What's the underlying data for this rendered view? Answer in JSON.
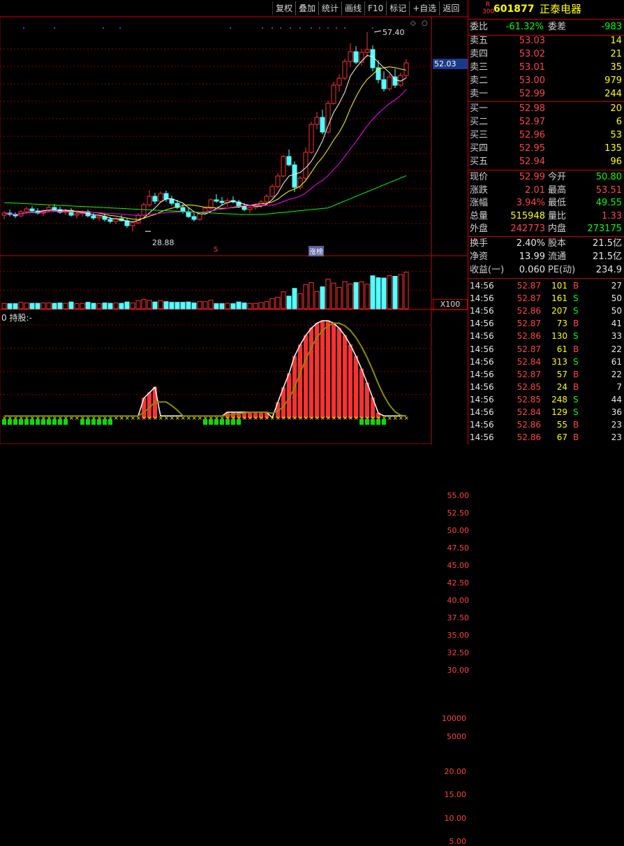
{
  "toolbar": [
    "复权",
    "叠加",
    "统计",
    "画线",
    "F10",
    "标记",
    "+自选",
    "返回"
  ],
  "stock": {
    "badge_top": "R",
    "badge_bottom": "300",
    "code": "601877",
    "name": "正泰电器"
  },
  "price_axis": [
    "55.00",
    "52.50",
    "50.00",
    "47.50",
    "45.00",
    "42.50",
    "40.00",
    "37.50",
    "35.00",
    "32.50",
    "30.00"
  ],
  "current_price_tag": "52.03",
  "high_marker": "57.40",
  "low_marker": "28.88",
  "event_marks": [
    "S",
    "涨榜"
  ],
  "volume_axis": [
    "10000",
    "5000"
  ],
  "volume_unit": "X100",
  "indicator_title": "0 持股:-",
  "indicator_axis": [
    "20.00",
    "15.00",
    "10.00",
    "5.00"
  ],
  "weibi": {
    "label": "委比",
    "value": "-61.32%",
    "diff_label": "委差",
    "diff": "-983"
  },
  "asks": [
    {
      "label": "卖五",
      "price": "53.03",
      "vol": "14"
    },
    {
      "label": "卖四",
      "price": "53.02",
      "vol": "21"
    },
    {
      "label": "卖三",
      "price": "53.01",
      "vol": "35"
    },
    {
      "label": "卖二",
      "price": "53.00",
      "vol": "979"
    },
    {
      "label": "卖一",
      "price": "52.99",
      "vol": "244"
    }
  ],
  "bids": [
    {
      "label": "买一",
      "price": "52.98",
      "vol": "20"
    },
    {
      "label": "买二",
      "price": "52.97",
      "vol": "6"
    },
    {
      "label": "买三",
      "price": "52.96",
      "vol": "53"
    },
    {
      "label": "买四",
      "price": "52.95",
      "vol": "135"
    },
    {
      "label": "买五",
      "price": "52.94",
      "vol": "96"
    }
  ],
  "stats": [
    {
      "l1": "现价",
      "v1": "52.99",
      "l2": "今开",
      "v2": "50.80",
      "c1": "red",
      "c2": "green"
    },
    {
      "l1": "涨跌",
      "v1": "2.01",
      "l2": "最高",
      "v2": "53.51",
      "c1": "red",
      "c2": "red"
    },
    {
      "l1": "涨幅",
      "v1": "3.94%",
      "l2": "最低",
      "v2": "49.55",
      "c1": "red",
      "c2": "green"
    },
    {
      "l1": "总量",
      "v1": "515948",
      "l2": "量比",
      "v2": "1.33",
      "c1": "yel",
      "c2": "red"
    },
    {
      "l1": "外盘",
      "v1": "242773",
      "l2": "内盘",
      "v2": "273175",
      "c1": "red",
      "c2": "green"
    }
  ],
  "fundamentals": [
    {
      "l1": "换手",
      "v1": "2.40%",
      "l2": "股本",
      "v2": "21.5亿"
    },
    {
      "l1": "净资",
      "v1": "13.99",
      "l2": "流通",
      "v2": "21.5亿"
    },
    {
      "l1": "收益(一)",
      "v1": "0.060",
      "l2": "PE(动)",
      "v2": "234.9"
    }
  ],
  "ticks": [
    {
      "t": "14:56",
      "p": "52.87",
      "v": "101",
      "s": "B",
      "n": "27"
    },
    {
      "t": "14:56",
      "p": "52.87",
      "v": "161",
      "s": "S",
      "n": "50"
    },
    {
      "t": "14:56",
      "p": "52.86",
      "v": "207",
      "s": "S",
      "n": "50"
    },
    {
      "t": "14:56",
      "p": "52.87",
      "v": "73",
      "s": "B",
      "n": "41"
    },
    {
      "t": "14:56",
      "p": "52.86",
      "v": "130",
      "s": "S",
      "n": "33"
    },
    {
      "t": "14:56",
      "p": "52.87",
      "v": "61",
      "s": "B",
      "n": "22"
    },
    {
      "t": "14:56",
      "p": "52.84",
      "v": "313",
      "s": "S",
      "n": "61"
    },
    {
      "t": "14:56",
      "p": "52.87",
      "v": "57",
      "s": "B",
      "n": "22"
    },
    {
      "t": "14:56",
      "p": "52.85",
      "v": "24",
      "s": "B",
      "n": "7"
    },
    {
      "t": "14:56",
      "p": "52.85",
      "v": "248",
      "s": "S",
      "n": "44"
    },
    {
      "t": "14:56",
      "p": "52.84",
      "v": "129",
      "s": "S",
      "n": "36"
    },
    {
      "t": "14:56",
      "p": "52.86",
      "v": "55",
      "s": "B",
      "n": "23"
    },
    {
      "t": "14:56",
      "p": "52.86",
      "v": "67",
      "s": "B",
      "n": "23"
    }
  ],
  "colors": {
    "up": "#ff3030",
    "down": "#54ffff",
    "ma5": "#ffffff",
    "ma10": "#ffff00",
    "ma20": "#ff00ff",
    "ma60": "#00ff00",
    "ma120": "#00c000",
    "grid": "#8b0000",
    "indicator_line": "#8b8b00"
  },
  "chart_data": {
    "type": "candlestick",
    "ylim": [
      28,
      58
    ],
    "candles": [
      [
        31.2,
        31.8,
        30.6,
        31.5
      ],
      [
        31.5,
        32.0,
        31.0,
        31.3
      ],
      [
        31.3,
        31.6,
        30.8,
        31.1
      ],
      [
        31.1,
        31.9,
        30.9,
        31.7
      ],
      [
        31.7,
        32.4,
        31.5,
        32.1
      ],
      [
        32.1,
        32.5,
        31.6,
        31.8
      ],
      [
        31.8,
        32.2,
        31.3,
        31.5
      ],
      [
        31.5,
        32.0,
        31.1,
        31.9
      ],
      [
        31.9,
        32.6,
        31.7,
        32.3
      ],
      [
        32.3,
        32.8,
        31.9,
        32.0
      ],
      [
        32.0,
        32.4,
        31.4,
        31.6
      ],
      [
        31.6,
        32.1,
        31.2,
        31.9
      ],
      [
        31.9,
        32.2,
        31.0,
        31.2
      ],
      [
        31.2,
        31.6,
        30.7,
        31.4
      ],
      [
        31.4,
        31.9,
        31.0,
        31.7
      ],
      [
        31.7,
        32.0,
        30.9,
        31.1
      ],
      [
        31.1,
        31.5,
        30.5,
        30.8
      ],
      [
        30.8,
        31.3,
        30.4,
        31.0
      ],
      [
        31.0,
        31.4,
        30.3,
        30.6
      ],
      [
        30.6,
        31.0,
        30.0,
        30.3
      ],
      [
        30.3,
        30.9,
        29.9,
        30.7
      ],
      [
        30.7,
        31.2,
        30.3,
        30.4
      ],
      [
        30.4,
        30.8,
        29.4,
        29.7
      ],
      [
        29.7,
        30.3,
        28.88,
        30.1
      ],
      [
        30.1,
        31.5,
        29.9,
        31.2
      ],
      [
        31.2,
        33.0,
        31.0,
        32.7
      ],
      [
        32.7,
        34.8,
        32.4,
        33.9
      ],
      [
        33.9,
        34.4,
        32.8,
        33.2
      ],
      [
        33.2,
        34.6,
        33.0,
        34.3
      ],
      [
        34.3,
        34.7,
        33.1,
        33.5
      ],
      [
        33.5,
        34.0,
        32.6,
        32.9
      ],
      [
        32.9,
        33.4,
        32.1,
        32.3
      ],
      [
        32.3,
        32.8,
        31.4,
        31.7
      ],
      [
        31.7,
        32.2,
        30.8,
        31.0
      ],
      [
        31.0,
        31.5,
        30.3,
        30.6
      ],
      [
        30.6,
        31.6,
        30.4,
        31.4
      ],
      [
        31.4,
        32.4,
        31.2,
        32.2
      ],
      [
        32.2,
        33.6,
        32.0,
        33.4
      ],
      [
        33.4,
        34.2,
        33.0,
        33.2
      ],
      [
        33.2,
        33.8,
        32.6,
        33.0
      ],
      [
        33.0,
        33.6,
        32.4,
        33.3
      ],
      [
        33.3,
        33.9,
        32.9,
        33.1
      ],
      [
        33.1,
        33.4,
        32.2,
        32.4
      ],
      [
        32.4,
        32.9,
        31.8,
        32.0
      ],
      [
        32.0,
        32.6,
        31.5,
        32.3
      ],
      [
        32.3,
        32.9,
        32.0,
        32.6
      ],
      [
        32.6,
        33.4,
        32.3,
        33.1
      ],
      [
        33.1,
        34.2,
        32.9,
        33.9
      ],
      [
        33.9,
        35.6,
        33.7,
        35.3
      ],
      [
        35.3,
        37.2,
        35.0,
        36.8
      ],
      [
        36.8,
        39.8,
        36.6,
        39.6
      ],
      [
        39.6,
        40.6,
        38.2,
        38.4
      ],
      [
        38.4,
        38.9,
        34.5,
        35.2
      ],
      [
        35.2,
        36.8,
        34.9,
        36.5
      ],
      [
        36.5,
        40.9,
        36.2,
        40.2
      ],
      [
        40.2,
        44.6,
        40.0,
        44.2
      ],
      [
        44.2,
        46.0,
        43.5,
        45.2
      ],
      [
        45.2,
        46.3,
        42.8,
        43.1
      ],
      [
        43.1,
        47.6,
        42.9,
        47.2
      ],
      [
        47.2,
        50.3,
        47.0,
        49.8
      ],
      [
        49.8,
        51.4,
        48.9,
        50.8
      ],
      [
        50.8,
        53.6,
        50.5,
        53.2
      ],
      [
        53.2,
        55.8,
        52.4,
        54.6
      ],
      [
        54.6,
        55.4,
        52.8,
        53.1
      ],
      [
        53.1,
        55.0,
        52.6,
        54.5
      ],
      [
        54.5,
        57.4,
        53.8,
        54.9
      ],
      [
        54.9,
        55.5,
        51.8,
        52.3
      ],
      [
        52.3,
        53.4,
        50.1,
        50.6
      ],
      [
        50.6,
        51.8,
        48.9,
        49.3
      ],
      [
        49.3,
        51.4,
        49.0,
        51.0
      ],
      [
        51.0,
        52.2,
        49.4,
        49.8
      ],
      [
        49.8,
        51.6,
        49.55,
        51.2
      ],
      [
        51.2,
        53.51,
        50.8,
        52.99
      ]
    ],
    "volume_ylim": [
      0,
      12000
    ],
    "indicator_ylim": [
      0,
      22
    ]
  }
}
